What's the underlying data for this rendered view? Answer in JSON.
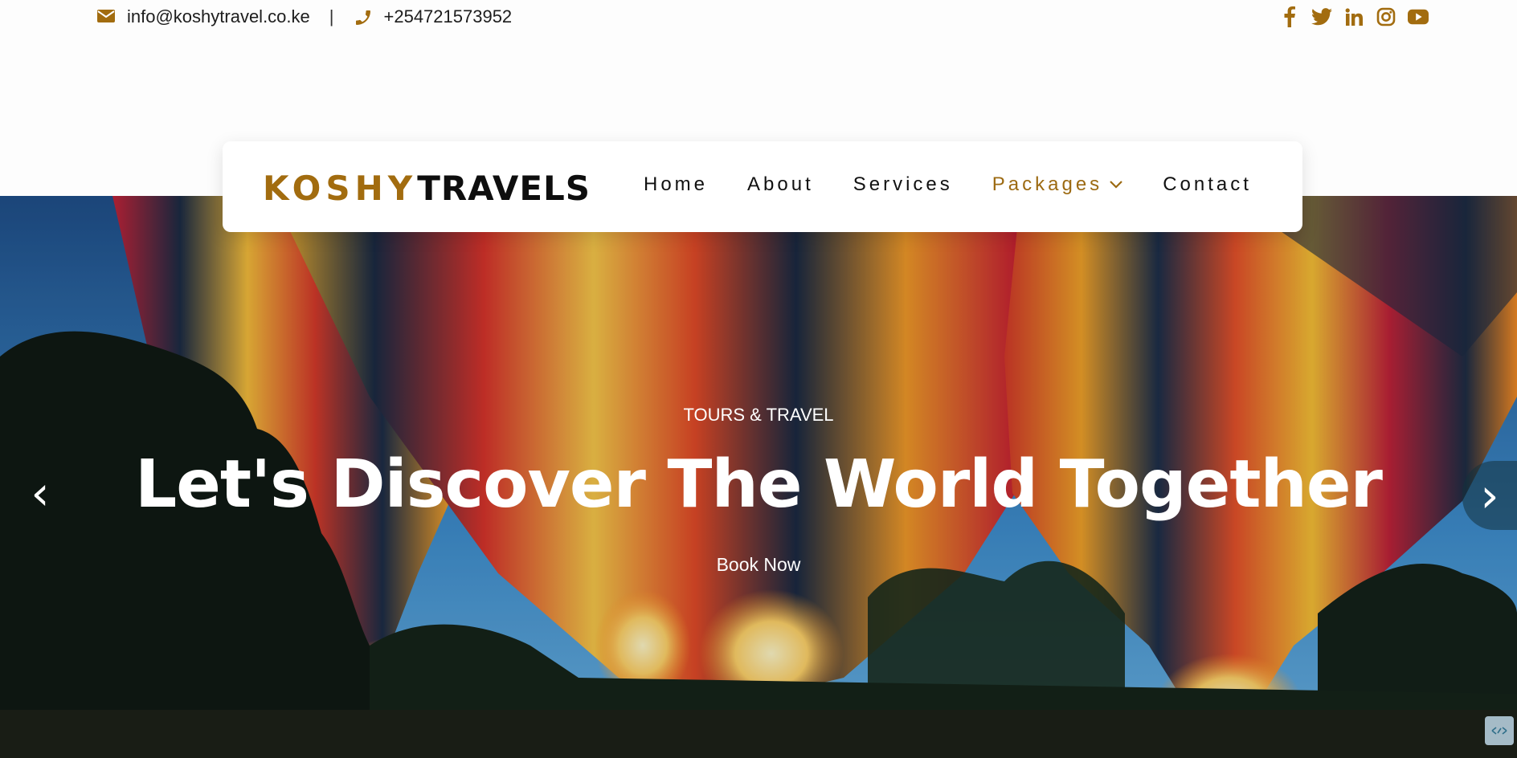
{
  "topbar": {
    "email": "info@koshytravel.co.ke",
    "separator": "|",
    "phone": "+254721573952",
    "social": [
      "facebook-icon",
      "twitter-icon",
      "linkedin-icon",
      "instagram-icon",
      "youtube-icon"
    ]
  },
  "brand": {
    "first": "KOSHY",
    "second": "TRAVELS"
  },
  "nav": {
    "home": "Home",
    "about": "About",
    "services": "Services",
    "packages": "Packages",
    "contact": "Contact"
  },
  "hero": {
    "tagline": "TOURS & TRAVEL",
    "headline": "Let's Discover The World Together",
    "cta": "Book Now",
    "prev": "‹",
    "next": "›"
  },
  "colors": {
    "accent": "#a26c0f",
    "text": "#111111",
    "white": "#ffffff"
  }
}
